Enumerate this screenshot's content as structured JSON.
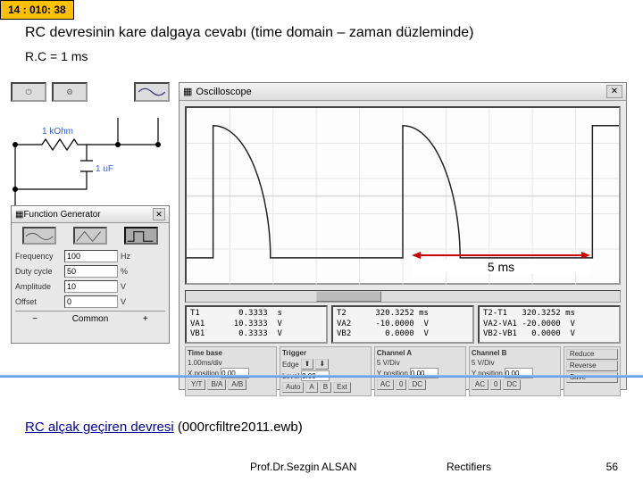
{
  "slide_number": "14  : 010: 38",
  "title": "RC devresinin kare dalgaya cevabı (time domain – zaman düzleminde)",
  "subtitle": "R.C = 1 ms",
  "circuit": {
    "resistor_label": "1 kOhm",
    "capacitor_label": "1 uF"
  },
  "function_generator": {
    "window_title": "Function Generator",
    "frequency_label": "Frequency",
    "frequency_value": "100",
    "frequency_unit": "Hz",
    "duty_label": "Duty cycle",
    "duty_value": "50",
    "duty_unit": "%",
    "amplitude_label": "Amplitude",
    "amplitude_value": "10",
    "amplitude_unit": "V",
    "offset_label": "Offset",
    "offset_value": "0",
    "offset_unit": "V",
    "terminal_minus": "−",
    "terminal_common": "Common",
    "terminal_plus": "+"
  },
  "oscilloscope": {
    "window_title": "Oscilloscope",
    "annotation": "5 ms",
    "readout1": "T1        0.3333  s\nVA1      10.3333  V\nVB1       0.3333  V",
    "readout2": "T2      320.3252 ms\nVA2     -10.0000  V\nVB2       0.0000  V",
    "readout3": "T2-T1   320.3252 ms\nVA2-VA1 -20.0000  V\nVB2-VB1   0.0000  V",
    "timebase": {
      "title": "Time base",
      "scale": "1.00ms/div",
      "xpos_label": "X position",
      "xpos_value": "0.00",
      "yt": "Y/T",
      "ba": "B/A",
      "ab": "A/B"
    },
    "trigger": {
      "title": "Trigger",
      "edge": "Edge",
      "level_label": "Level",
      "level_value": "0.00",
      "auto": "Auto",
      "a": "A",
      "b": "B",
      "ext": "Ext"
    },
    "channel_a": {
      "title": "Channel A",
      "scale": "5 V/Div",
      "ypos_label": "Y position",
      "ypos_value": "0.00",
      "ac": "AC",
      "zero": "0",
      "dc": "DC"
    },
    "channel_b": {
      "title": "Channel B",
      "scale": "5 V/Div",
      "ypos_label": "Y position",
      "ypos_value": "0.00",
      "ac": "AC",
      "zero": "0",
      "dc": "DC"
    },
    "reduce": {
      "reduce": "Reduce",
      "reverse": "Reverse",
      "save": "Save"
    }
  },
  "footer_link_text": "RC alçak geçiren devresi",
  "footer_link_file": "(000rcfiltre2011.ewb)",
  "prof": "Prof.Dr.Sezgin ALSAN",
  "section": "Rectifiers",
  "page": "56"
}
